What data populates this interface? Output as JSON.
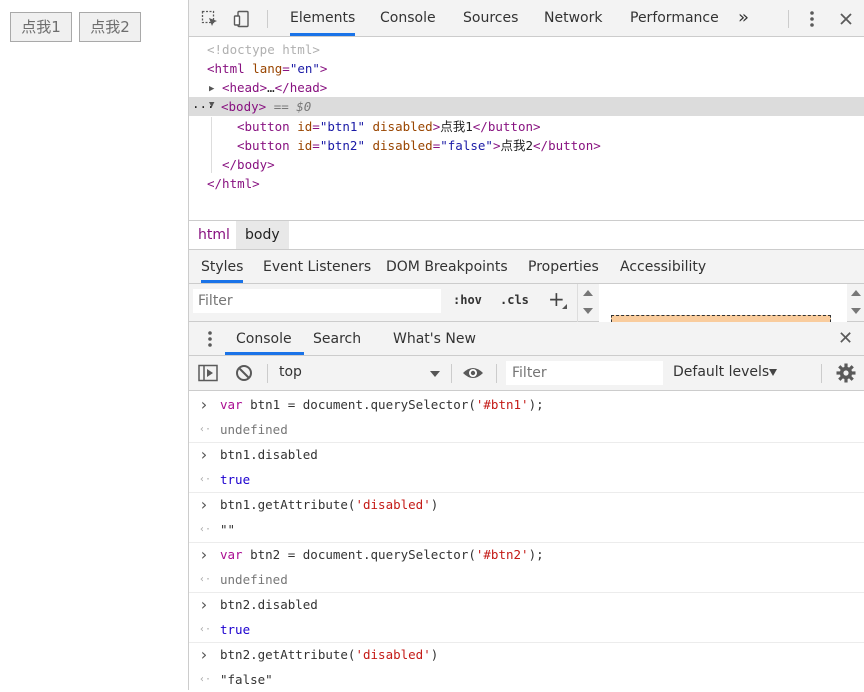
{
  "page": {
    "btn1_label": "点我1",
    "btn2_label": "点我2"
  },
  "devtools": {
    "tabs": [
      "Elements",
      "Console",
      "Sources",
      "Network",
      "Performance"
    ],
    "more_tabs": "»",
    "dom": {
      "doctype": "<!doctype html>",
      "html_open_tag": "html",
      "html_lang_attr": "lang",
      "html_lang_val": "\"en\"",
      "head_collapsed_open": "<head>",
      "head_ellipsis": "…",
      "head_close": "</head>",
      "body_open": "<body>",
      "body_selected_marker": "== $0",
      "btn1_tag": "button",
      "btn1_id_attr": "id",
      "btn1_id_val": "\"btn1\"",
      "btn1_disabled_attr": "disabled",
      "btn1_text": "点我1",
      "btn2_tag": "button",
      "btn2_id_attr": "id",
      "btn2_id_val": "\"btn2\"",
      "btn2_disabled_attr": "disabled",
      "btn2_disabled_val": "\"false\"",
      "btn2_text": "点我2",
      "body_close": "</body>",
      "html_close": "</html>",
      "ellipsis_marker": "..."
    },
    "breadcrumbs": [
      "html",
      "body"
    ],
    "styles_tabs": [
      "Styles",
      "Event Listeners",
      "DOM Breakpoints",
      "Properties",
      "Accessibility"
    ],
    "styles_filter": {
      "placeholder": "Filter",
      "hov": ":hov",
      "cls": ".cls",
      "add": "+"
    },
    "drawer": {
      "tabs": [
        "Console",
        "Search",
        "What's New"
      ],
      "close": "✕"
    },
    "console_toolbar": {
      "context": "top",
      "filter_placeholder": "Filter",
      "levels": "Default levels"
    },
    "console": [
      {
        "type": "input",
        "parts": [
          [
            "kw",
            "var"
          ],
          [
            "plain",
            " btn1 = document.querySelector("
          ],
          [
            "str",
            "'#btn1'"
          ],
          [
            "plain",
            ");"
          ]
        ]
      },
      {
        "type": "output",
        "parts": [
          [
            "undef",
            "undefined"
          ]
        ]
      },
      {
        "type": "input",
        "parts": [
          [
            "plain",
            "btn1.disabled"
          ]
        ]
      },
      {
        "type": "output",
        "parts": [
          [
            "bool",
            "true"
          ]
        ]
      },
      {
        "type": "input",
        "parts": [
          [
            "plain",
            "btn1.getAttribute("
          ],
          [
            "str",
            "'disabled'"
          ],
          [
            "plain",
            ")"
          ]
        ]
      },
      {
        "type": "output",
        "parts": [
          [
            "plain",
            "\"\""
          ]
        ]
      },
      {
        "type": "input",
        "parts": [
          [
            "kw",
            "var"
          ],
          [
            "plain",
            " btn2 = document.querySelector("
          ],
          [
            "str",
            "'#btn2'"
          ],
          [
            "plain",
            ");"
          ]
        ]
      },
      {
        "type": "output",
        "parts": [
          [
            "undef",
            "undefined"
          ]
        ]
      },
      {
        "type": "input",
        "parts": [
          [
            "plain",
            "btn2.disabled"
          ]
        ]
      },
      {
        "type": "output",
        "parts": [
          [
            "bool",
            "true"
          ]
        ]
      },
      {
        "type": "input",
        "parts": [
          [
            "plain",
            "btn2.getAttribute("
          ],
          [
            "str",
            "'disabled'"
          ],
          [
            "plain",
            ")"
          ]
        ]
      },
      {
        "type": "output",
        "parts": [
          [
            "plain",
            "\"false\""
          ]
        ]
      }
    ],
    "colors": {
      "accent": "#1a73e8",
      "tag": "#881280",
      "attr": "#994500",
      "value": "#1a1aa6"
    }
  }
}
